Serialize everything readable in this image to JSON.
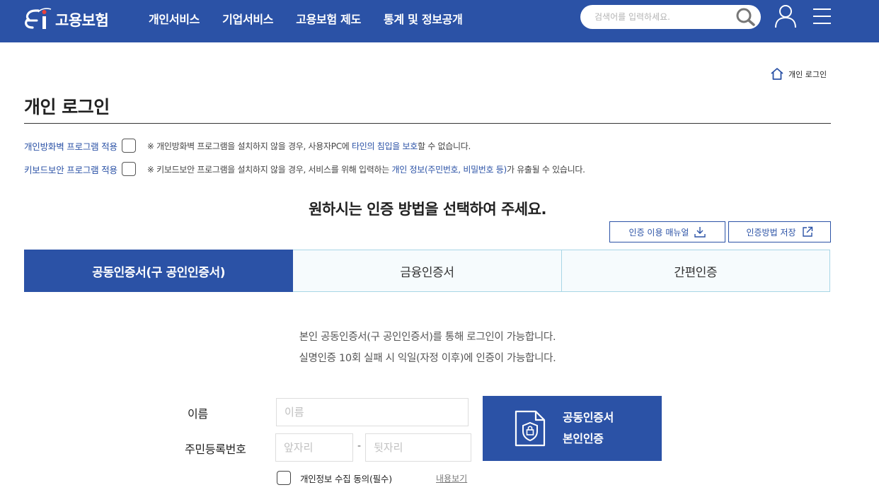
{
  "header": {
    "logo_text": "고용보험",
    "nav": [
      "개인서비스",
      "기업서비스",
      "고용보험 제도",
      "통계 및 정보공개"
    ],
    "search_placeholder": "검색어를 입력하세요."
  },
  "breadcrumb": {
    "current": "개인 로그인"
  },
  "page_title": "개인 로그인",
  "security": {
    "firewall": {
      "label": "개인방화벽 프로그램 적용",
      "note_prefix": "※ 개인방화벽 프로그램을 설치하지 않을 경우, 사용자PC에 ",
      "note_hl": "타인의 침입을 보호",
      "note_suffix": "할 수 없습니다."
    },
    "keyboard": {
      "label": "키보드보안 프로그램 적용",
      "note_prefix": "※ 키보드보안 프로그램을 설치하지 않을 경우, 서비스를 위해 입력하는 ",
      "note_hl": "개인 정보(주민번호, 비밀번호 등)",
      "note_suffix": "가 유출될 수 있습니다."
    }
  },
  "select_title": "원하시는 인증 방법을 선택하여 주세요.",
  "buttons": {
    "manual": "인증 이용 매뉴얼",
    "save_method": "인증방법 저장"
  },
  "tabs": [
    "공동인증서(구 공인인증서)",
    "금융인증서",
    "간편인증"
  ],
  "info": [
    "본인 공동인증서(구 공인인증서)를 통해 로그인이 가능합니다.",
    "실명인증 10회 실패 시 익일(자정 이후)에 인증이 가능합니다."
  ],
  "form": {
    "name_label": "이름",
    "name_placeholder": "이름",
    "rrn_label": "주민등록번호",
    "rrn_front_placeholder": "앞자리",
    "rrn_back_placeholder": "뒷자리",
    "dash": "-",
    "agree_label": "개인정보 수집 동의(필수)",
    "agree_link": "내용보기"
  },
  "cert_button": {
    "line1": "공동인증서",
    "line2": "본인인증"
  },
  "colors": {
    "brand": "#2b52a6",
    "tab_border": "#a8d6e6"
  }
}
